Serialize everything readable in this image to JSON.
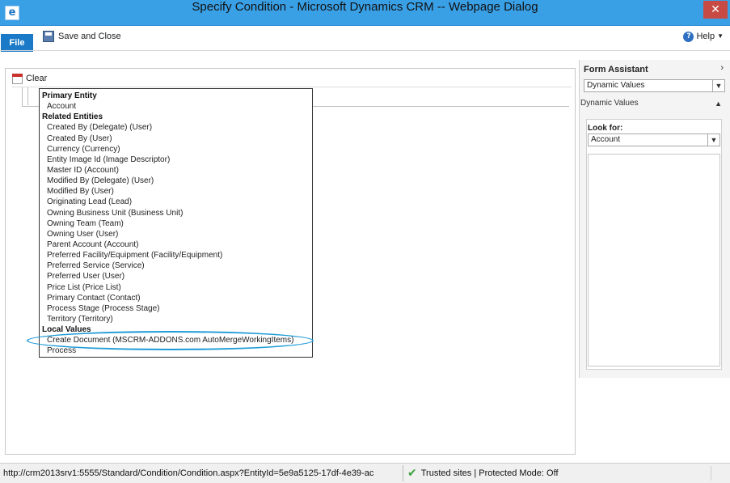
{
  "window": {
    "title": "Specify Condition - Microsoft Dynamics CRM -- Webpage Dialog",
    "app_icon": "ie-page-icon",
    "close_glyph": "✕"
  },
  "ribbon": {
    "file_label": "File",
    "save_close_label": "Save and Close",
    "help_label": "Help"
  },
  "main": {
    "clear_label": "Clear"
  },
  "dropdown": {
    "primary_header": "Primary Entity",
    "primary_items": [
      "Account"
    ],
    "related_header": "Related Entities",
    "related_items": [
      "Created By (Delegate) (User)",
      "Created By (User)",
      "Currency (Currency)",
      "Entity Image Id (Image Descriptor)",
      "Master ID (Account)",
      "Modified By (Delegate) (User)",
      "Modified By (User)",
      "Originating Lead (Lead)",
      "Owning Business Unit (Business Unit)",
      "Owning Team (Team)",
      "Owning User (User)",
      "Parent Account (Account)",
      "Preferred Facility/Equipment (Facility/Equipment)",
      "Preferred Service (Service)",
      "Preferred User (User)",
      "Price List (Price List)",
      "Primary Contact (Contact)",
      "Process Stage (Process Stage)",
      "Territory (Territory)"
    ],
    "local_header": "Local Values",
    "local_items": [
      "Create Document (MSCRM-ADDONS.com AutoMergeWorkingItems)",
      "Process"
    ],
    "highlight_color": "#1e9bd7"
  },
  "form_assistant": {
    "title": "Form Assistant",
    "collapse_glyph": "›",
    "selected": "Dynamic Values",
    "section_label": "Dynamic Values",
    "look_for_label": "Look for:",
    "look_for_value": "Account"
  },
  "statusbar": {
    "url": "http://crm2013srv1:5555/Standard/Condition/Condition.aspx?EntityId=5e9a5125-17df-4e39-ac",
    "zone": "Trusted sites | Protected Mode: Off",
    "zone_icon": "check-icon"
  }
}
